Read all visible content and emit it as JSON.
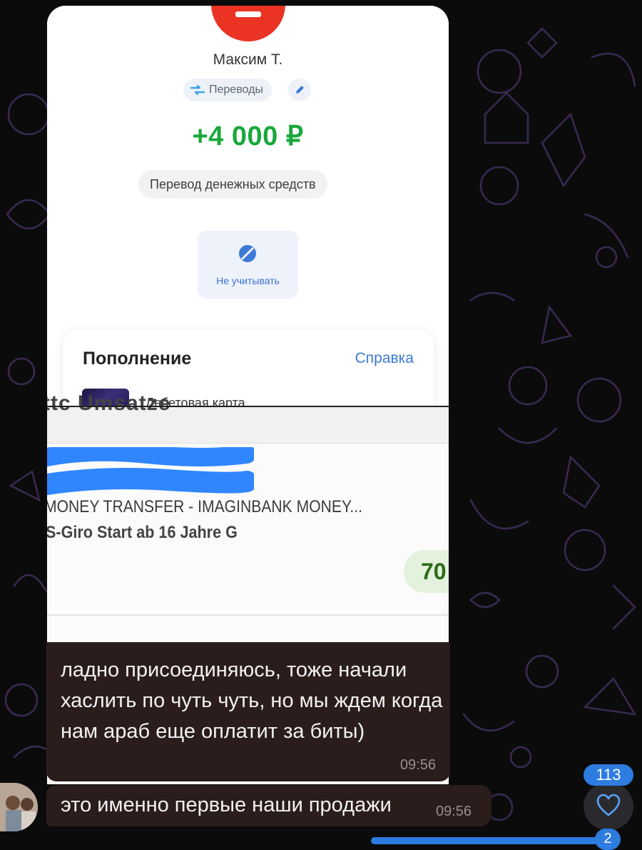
{
  "bank_screen": {
    "contact_name": "Максим Т.",
    "category_chip": "Переводы",
    "amount": "+4 000 ₽",
    "description": "Перевод денежных средств",
    "ignore_button": "Не учитывать",
    "section_title": "Пополнение",
    "help_link": "Справка",
    "card_label_partial": "Дебетовая карта",
    "colors": {
      "amount_green": "#1aa83c",
      "brand_red": "#ea3323",
      "link_blue": "#3d7ad6"
    }
  },
  "bank_screen_2": {
    "header_partial": "ttc Umsatze",
    "transaction_title": "MONEY TRANSFER - IMAGINBANK MONEY...",
    "account_line": "S-Giro Start ab 16 Jahre G",
    "amount_partial": "70"
  },
  "chat": {
    "messages": [
      {
        "text": "ладно присоединяюсь, тоже начали хаслить по чуть чуть, но мы ждем когда нам араб еще оплатит за биты)",
        "time": "09:56"
      },
      {
        "text": "это именно первые наши продажи",
        "time": "09:56"
      }
    ],
    "reaction": {
      "icon": "heart-icon",
      "count": "113"
    },
    "unread_badge": "2",
    "colors": {
      "bubble": "#2b1d1b",
      "accent": "#2d7ce0"
    }
  }
}
